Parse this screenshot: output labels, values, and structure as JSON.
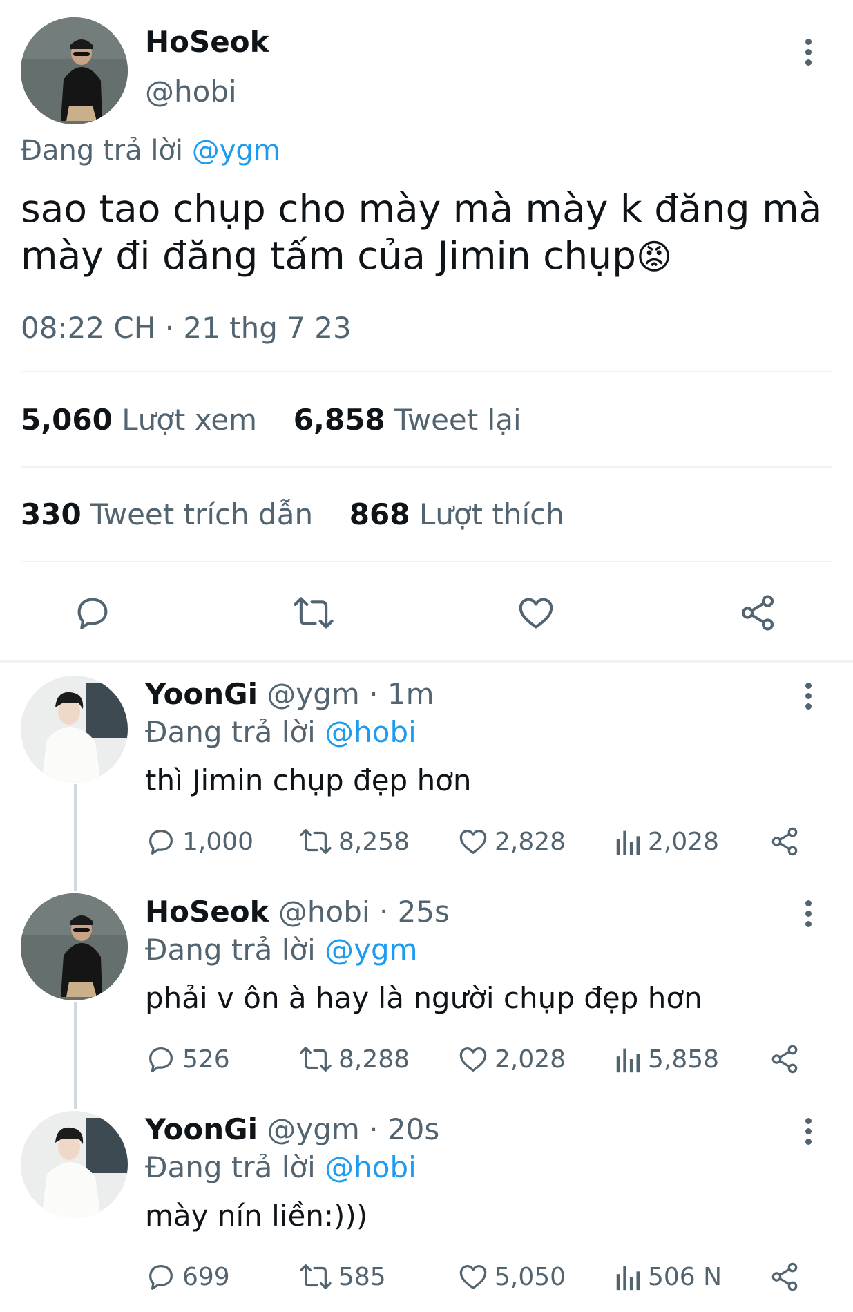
{
  "main_tweet": {
    "display_name": "HoSeok",
    "handle": "@hobi",
    "reply_prefix": "Đang trả lời",
    "reply_to": "@ygm",
    "text_line1": "sao tao chụp cho mày mà mày k đăng mà",
    "text_line2": "mày đi đăng tấm của Jimin chụp",
    "emoji": "😡",
    "timestamp": "08:22 CH · 21 thg 7 23",
    "stats": {
      "views_count": "5,060",
      "views_label": "Lượt xem",
      "retweets_count": "6,858",
      "retweets_label": "Tweet lại",
      "quotes_count": "330",
      "quotes_label": "Tweet trích dẫn",
      "likes_count": "868",
      "likes_label": "Lượt thích"
    }
  },
  "replies": [
    {
      "display_name": "YoonGi",
      "handle": "@ygm",
      "time": "· 1m",
      "reply_prefix": "Đang trả lời",
      "reply_to": "@hobi",
      "text": "thì Jimin chụp đẹp hơn",
      "replies": "1,000",
      "retweets": "8,258",
      "likes": "2,828",
      "views": "2,028"
    },
    {
      "display_name": "HoSeok",
      "handle": "@hobi",
      "time": "· 25s",
      "reply_prefix": "Đang trả lời",
      "reply_to": "@ygm",
      "text": "phải v ôn à hay là người chụp đẹp hơn",
      "replies": "526",
      "retweets": "8,288",
      "likes": "2,028",
      "views": "5,858"
    },
    {
      "display_name": "YoonGi",
      "handle": "@ygm",
      "time": "· 20s",
      "reply_prefix": "Đang trả lời",
      "reply_to": "@hobi",
      "text": "mày nín liền:)))",
      "replies": "699",
      "retweets": "585",
      "likes": "5,050",
      "views": "506 N"
    }
  ],
  "colors": {
    "accent": "#1d9bf0",
    "muted": "#536471",
    "text": "#0f1419",
    "divider": "#eff3f4"
  },
  "icons": [
    "reply-icon",
    "retweet-icon",
    "like-icon",
    "share-icon",
    "views-icon",
    "more-icon"
  ]
}
